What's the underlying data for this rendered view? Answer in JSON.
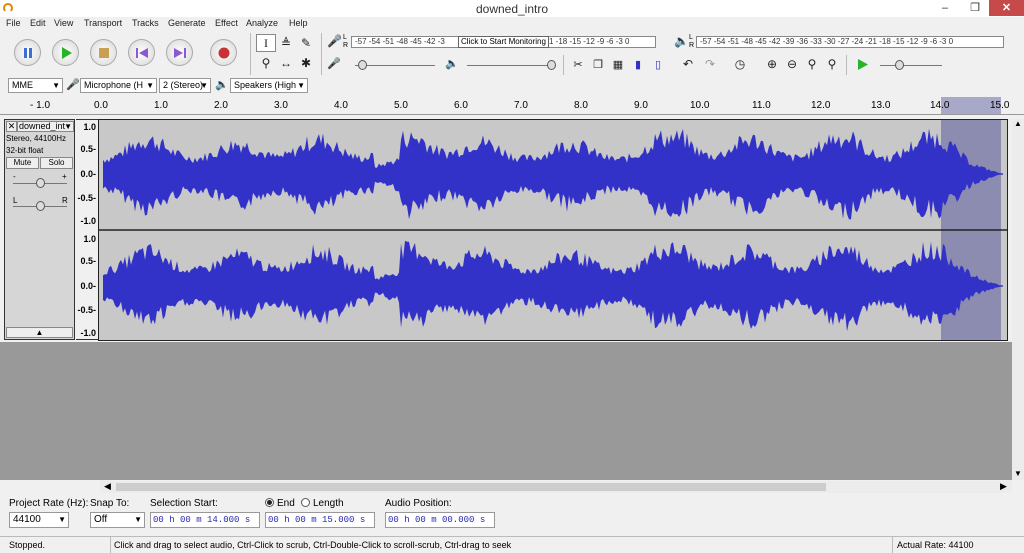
{
  "window": {
    "title": "downed_intro"
  },
  "menu": [
    "File",
    "Edit",
    "View",
    "Transport",
    "Tracks",
    "Generate",
    "Effect",
    "Analyze",
    "Help"
  ],
  "meters": {
    "record_scale": "-57 -54 -51 -48 -45 -42 -3",
    "record_tooltip": "Click to Start Monitoring",
    "record_scale_tail": "1 -18 -15 -12 -9 -6 -3 0",
    "play_scale": "-57 -54 -51 -48 -45 -42 -39 -36 -33 -30 -27 -24 -21 -18 -15 -12 -9 -6 -3 0",
    "L": "L",
    "R": "R"
  },
  "device": {
    "host": "MME",
    "mic": "Microphone (H",
    "channels": "2 (Stereo)",
    "speakers": "Speakers (High"
  },
  "ruler_ticks": [
    "- 1.0",
    "0.0",
    "1.0",
    "2.0",
    "3.0",
    "4.0",
    "5.0",
    "6.0",
    "7.0",
    "8.0",
    "9.0",
    "10.0",
    "11.0",
    "12.0",
    "13.0",
    "14.0",
    "15.0"
  ],
  "track": {
    "name": "downed_int",
    "info1": "Stereo, 44100Hz",
    "info2": "32-bit float",
    "mute": "Mute",
    "solo": "Solo",
    "gain_minus": "-",
    "gain_plus": "+",
    "pan_l": "L",
    "pan_r": "R",
    "vscale": [
      "1.0",
      "0.5-",
      "0.0-",
      "-0.5-",
      "-1.0"
    ]
  },
  "selection": {
    "start_sec": 14.0,
    "end_sec": 15.0
  },
  "bottom": {
    "project_rate_label": "Project Rate (Hz):",
    "project_rate": "44100",
    "snap_label": "Snap To:",
    "snap_value": "Off",
    "sel_start_label": "Selection Start:",
    "end_label": "End",
    "length_label": "Length",
    "sel_start": "00 h 00 m 14.000 s",
    "sel_end": "00 h 00 m 15.000 s",
    "audio_pos_label": "Audio Position:",
    "audio_pos": "00 h 00 m 00.000 s"
  },
  "status": {
    "state": "Stopped.",
    "hint": "Click and drag to select audio, Ctrl-Click to scrub, Ctrl-Double-Click to scroll-scrub, Ctrl-drag to seek",
    "rate": "Actual Rate: 44100"
  },
  "colors": {
    "wave": "#3232c8",
    "selection": "#8c8cb0",
    "record": "#c83232",
    "play": "#28b428"
  }
}
